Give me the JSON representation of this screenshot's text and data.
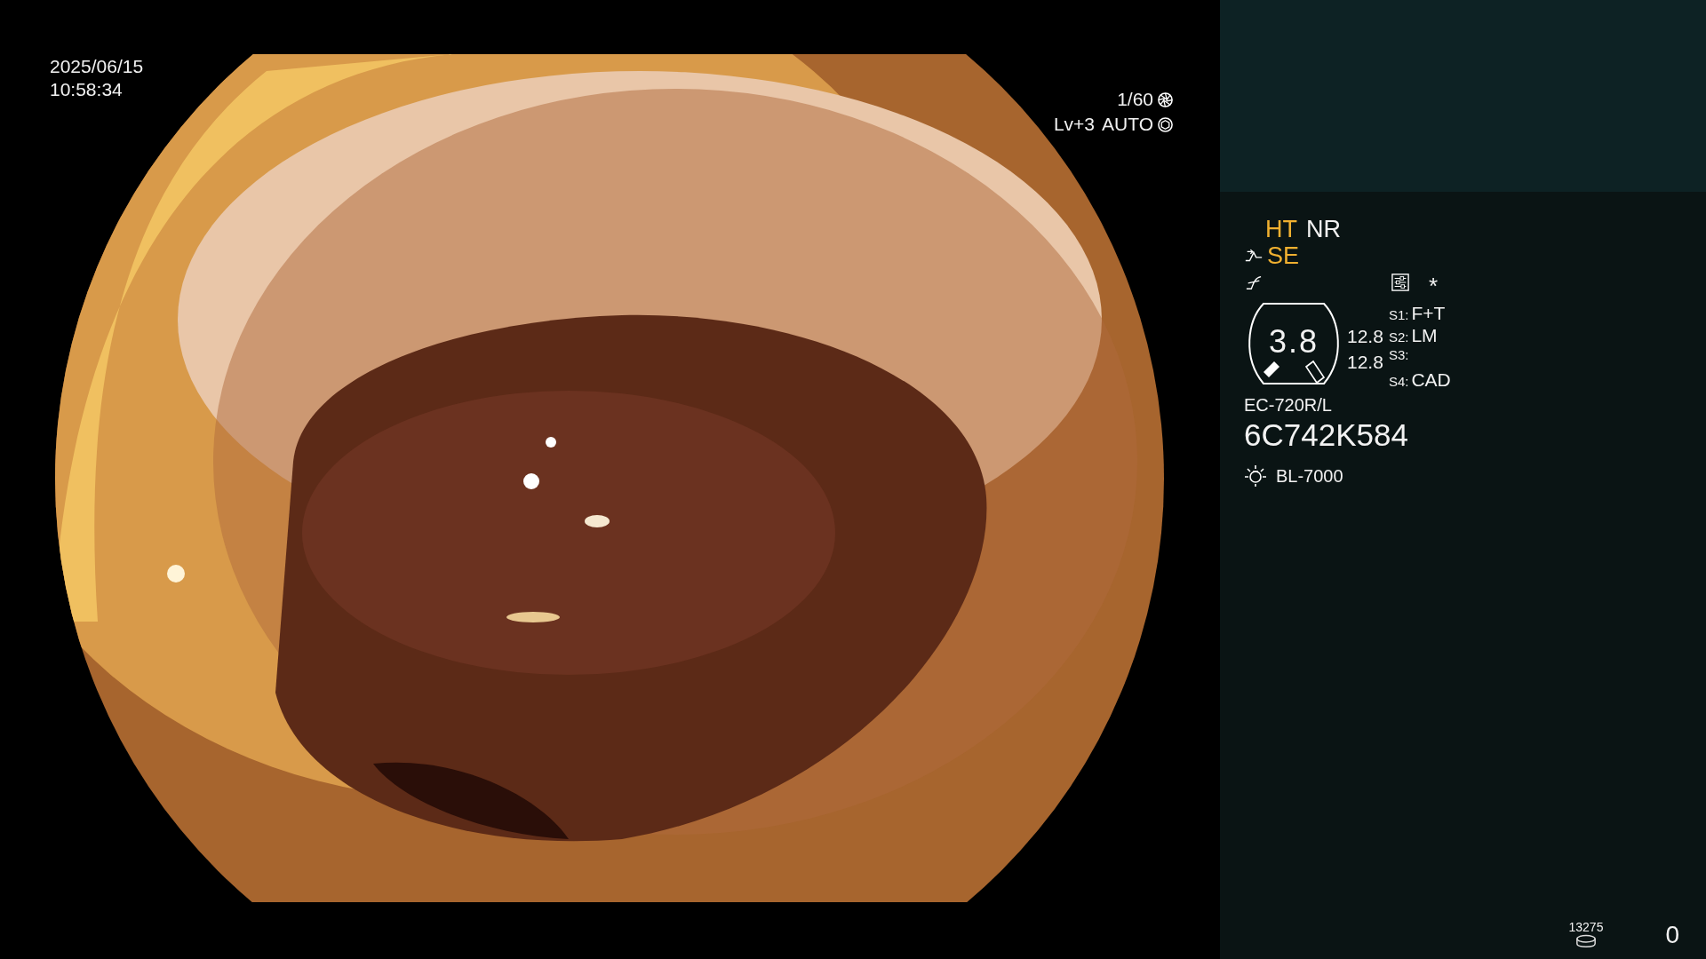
{
  "video": {
    "date": "2025/06/15",
    "time": "10:58:34",
    "shutter": "1/60",
    "brightness": "Lv+3",
    "iris": "AUTO"
  },
  "panel": {
    "modes": [
      {
        "label": "HT",
        "on": true
      },
      {
        "label": "NR",
        "on": false
      }
    ],
    "enhance": {
      "label": "SE",
      "on": true
    },
    "asterisk": "*",
    "gauge": {
      "value": "3.8"
    },
    "readings": [
      "12.8",
      "12.8"
    ],
    "switches": [
      {
        "key": "S1:",
        "value": "F+T"
      },
      {
        "key": "S2:",
        "value": "LM"
      },
      {
        "key": "S3:"
      },
      {
        "key": "S4:",
        "value": "CAD"
      }
    ],
    "scope_model": "EC-720R/L",
    "serial": "6C742K584",
    "light_source": "BL-7000"
  },
  "storage": {
    "count": "13275"
  },
  "counter": "0"
}
